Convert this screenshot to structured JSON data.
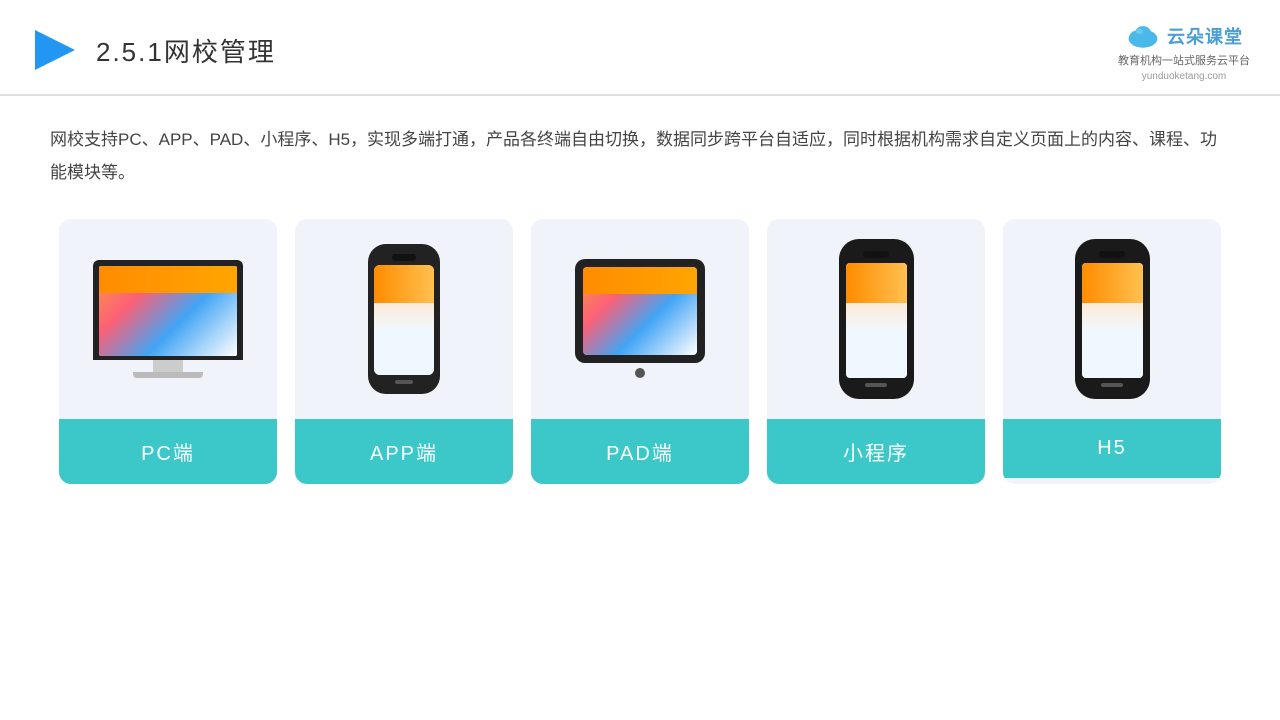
{
  "header": {
    "title_prefix": "2.5.1",
    "title_main": "网校管理",
    "logo_main": "云朵课堂",
    "logo_url": "yunduoketang.com",
    "logo_tagline_line1": "教育机构一站",
    "logo_tagline_line2": "式服务云平台"
  },
  "description": "网校支持PC、APP、PAD、小程序、H5，实现多端打通，产品各终端自由切换，数据同步跨平台自适应，同时根据机构需求自定义页面上的内容、课程、功能模块等。",
  "cards": [
    {
      "id": "pc",
      "label": "PC端",
      "type": "pc"
    },
    {
      "id": "app",
      "label": "APP端",
      "type": "phone"
    },
    {
      "id": "pad",
      "label": "PAD端",
      "type": "tablet"
    },
    {
      "id": "miniprogram",
      "label": "小程序",
      "type": "mini-phone"
    },
    {
      "id": "h5",
      "label": "H5",
      "type": "mini-phone"
    }
  ],
  "accent_color": "#3cc8c8"
}
